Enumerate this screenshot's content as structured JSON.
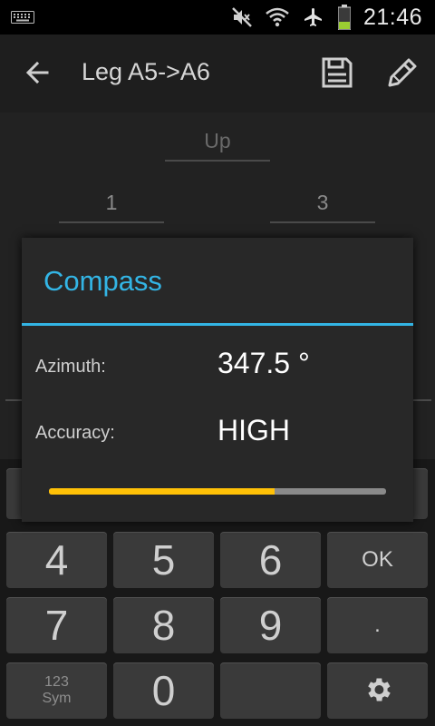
{
  "status_bar": {
    "time": "21:46",
    "icons": [
      "keyboard-icon",
      "mute-icon",
      "wifi-icon",
      "airplane-icon",
      "battery-icon"
    ],
    "battery_color": "#9acd32"
  },
  "action_bar": {
    "title": "Leg A5->A6",
    "icons": [
      "back-arrow-icon",
      "save-icon",
      "edit-icon"
    ]
  },
  "form": {
    "up_placeholder": "Up",
    "field_left_value": "1",
    "field_right_value": "3"
  },
  "dialog": {
    "title": "Compass",
    "azimuth_label": "Azimuth:",
    "azimuth_value": "347.5 °",
    "accuracy_label": "Accuracy:",
    "accuracy_value": "HIGH",
    "progress": 0.67,
    "accent_color": "#33b5e5",
    "progress_color": "#ffc107"
  },
  "keyboard": {
    "keys": [
      "4",
      "5",
      "6",
      "OK",
      "7",
      "8",
      "9",
      ".",
      "123",
      "Sym",
      "0",
      "",
      "settings-icon"
    ]
  }
}
